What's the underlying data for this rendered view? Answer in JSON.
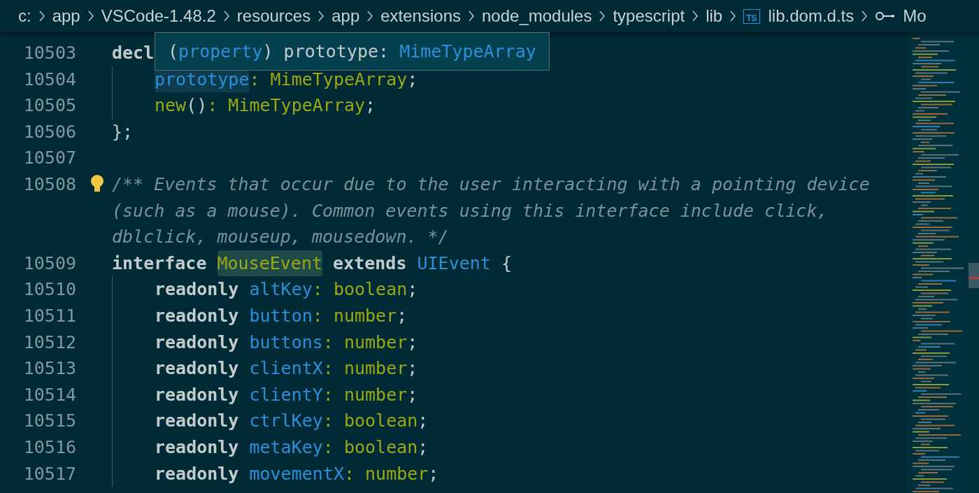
{
  "breadcrumb": [
    {
      "text": "c:",
      "kind": "folder"
    },
    {
      "text": "app",
      "kind": "folder"
    },
    {
      "text": "VSCode-1.48.2",
      "kind": "folder"
    },
    {
      "text": "resources",
      "kind": "folder"
    },
    {
      "text": "app",
      "kind": "folder"
    },
    {
      "text": "extensions",
      "kind": "folder"
    },
    {
      "text": "node_modules",
      "kind": "folder"
    },
    {
      "text": "typescript",
      "kind": "folder"
    },
    {
      "text": "lib",
      "kind": "folder"
    },
    {
      "text": "lib.dom.d.ts",
      "kind": "file",
      "badge": "TS"
    },
    {
      "text": "Mo",
      "kind": "symbol"
    }
  ],
  "hover": [
    {
      "text": "(",
      "kind": "punct"
    },
    {
      "text": "property",
      "kind": "prop"
    },
    {
      "text": ") prototype: ",
      "kind": "punct"
    },
    {
      "text": "MimeTypeArray",
      "kind": "prop"
    }
  ],
  "lines": [
    {
      "number": "10503",
      "indented": false,
      "rows": [
        [
          {
            "text": "decl",
            "kind": "keyword"
          }
        ]
      ]
    },
    {
      "number": "10504",
      "indented": true,
      "rows": [
        [
          {
            "text": "prototype",
            "kind": "prop",
            "highlighted": true
          },
          {
            "text": ": MimeTypeArray",
            "kind": "type"
          },
          {
            "text": ";",
            "kind": "punct"
          }
        ]
      ]
    },
    {
      "number": "10505",
      "indented": true,
      "rows": [
        [
          {
            "text": "new",
            "kind": "type"
          },
          {
            "text": "()",
            "kind": "punct"
          },
          {
            "text": ": MimeTypeArray",
            "kind": "type"
          },
          {
            "text": ";",
            "kind": "punct"
          }
        ]
      ]
    },
    {
      "number": "10506",
      "indented": false,
      "rows": [
        [
          {
            "text": "};",
            "kind": "punct"
          }
        ]
      ]
    },
    {
      "number": "10507",
      "indented": false,
      "rows": [
        []
      ]
    },
    {
      "number": "10508",
      "indented": false,
      "lightbulb": true,
      "rows": [
        [
          {
            "text": "/** Events that occur due to the user interacting with a pointing device",
            "kind": "comment"
          }
        ],
        [
          {
            "text": "(such as a mouse). Common events using this interface include click,",
            "kind": "comment"
          }
        ],
        [
          {
            "text": "dblclick, mouseup, mousedown. */",
            "kind": "comment"
          }
        ]
      ]
    },
    {
      "number": "10509",
      "indented": false,
      "rows": [
        [
          {
            "text": "interface ",
            "kind": "keyword"
          },
          {
            "text": "MouseEvent",
            "kind": "type",
            "highlighted": true
          },
          {
            "text": " extends ",
            "kind": "keyword"
          },
          {
            "text": "UIEvent",
            "kind": "prop"
          },
          {
            "text": " {",
            "kind": "punct"
          }
        ]
      ]
    },
    {
      "number": "10510",
      "indented": true,
      "rows": [
        [
          {
            "text": "readonly ",
            "kind": "keyword"
          },
          {
            "text": "altKey",
            "kind": "prop"
          },
          {
            "text": ": boolean",
            "kind": "type"
          },
          {
            "text": ";",
            "kind": "punct"
          }
        ]
      ]
    },
    {
      "number": "10511",
      "indented": true,
      "rows": [
        [
          {
            "text": "readonly ",
            "kind": "keyword"
          },
          {
            "text": "button",
            "kind": "prop"
          },
          {
            "text": ": number",
            "kind": "type"
          },
          {
            "text": ";",
            "kind": "punct"
          }
        ]
      ]
    },
    {
      "number": "10512",
      "indented": true,
      "rows": [
        [
          {
            "text": "readonly ",
            "kind": "keyword"
          },
          {
            "text": "buttons",
            "kind": "prop"
          },
          {
            "text": ": number",
            "kind": "type"
          },
          {
            "text": ";",
            "kind": "punct"
          }
        ]
      ]
    },
    {
      "number": "10513",
      "indented": true,
      "rows": [
        [
          {
            "text": "readonly ",
            "kind": "keyword"
          },
          {
            "text": "clientX",
            "kind": "prop"
          },
          {
            "text": ": number",
            "kind": "type"
          },
          {
            "text": ";",
            "kind": "punct"
          }
        ]
      ]
    },
    {
      "number": "10514",
      "indented": true,
      "rows": [
        [
          {
            "text": "readonly ",
            "kind": "keyword"
          },
          {
            "text": "clientY",
            "kind": "prop"
          },
          {
            "text": ": number",
            "kind": "type"
          },
          {
            "text": ";",
            "kind": "punct"
          }
        ]
      ]
    },
    {
      "number": "10515",
      "indented": true,
      "rows": [
        [
          {
            "text": "readonly ",
            "kind": "keyword"
          },
          {
            "text": "ctrlKey",
            "kind": "prop"
          },
          {
            "text": ": boolean",
            "kind": "type"
          },
          {
            "text": ";",
            "kind": "punct"
          }
        ]
      ]
    },
    {
      "number": "10516",
      "indented": true,
      "rows": [
        [
          {
            "text": "readonly ",
            "kind": "keyword"
          },
          {
            "text": "metaKey",
            "kind": "prop"
          },
          {
            "text": ": boolean",
            "kind": "type"
          },
          {
            "text": ";",
            "kind": "punct"
          }
        ]
      ]
    },
    {
      "number": "10517",
      "indented": true,
      "rows": [
        [
          {
            "text": "readonly ",
            "kind": "keyword"
          },
          {
            "text": "movementX",
            "kind": "prop"
          },
          {
            "text": ": number",
            "kind": "type"
          },
          {
            "text": ";",
            "kind": "punct"
          }
        ]
      ]
    }
  ]
}
